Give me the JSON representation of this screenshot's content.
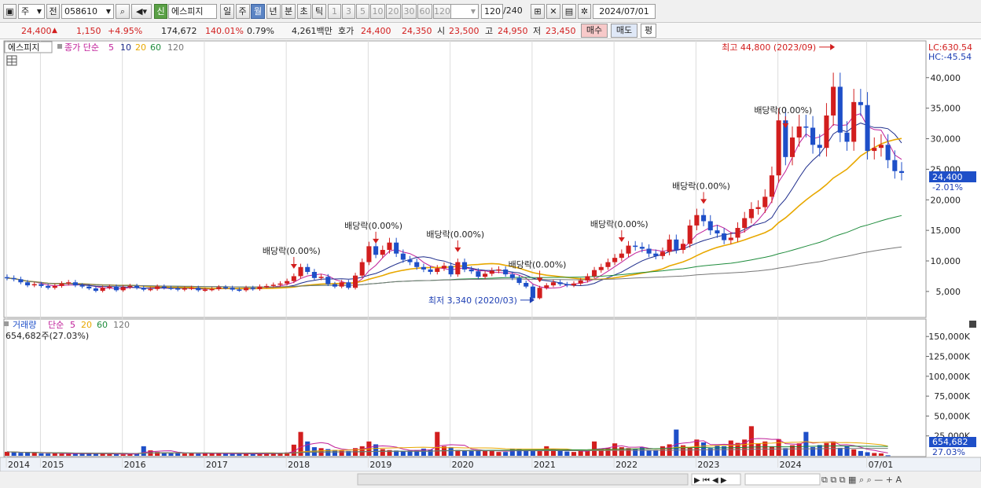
{
  "toolbar": {
    "market": "주",
    "prev": "전",
    "code": "058610",
    "stock_badge": "신",
    "stock_name": "에스피지",
    "periods": [
      "일",
      "주",
      "월",
      "년",
      "분",
      "초",
      "틱"
    ],
    "active_period": "월",
    "intervals": [
      "1",
      "3",
      "5",
      "10",
      "20",
      "30",
      "60",
      "120"
    ],
    "count": "120",
    "count_total": "/240",
    "date": "2024/07/01"
  },
  "quote": {
    "price": "24,400",
    "change": "1,150",
    "change_pct": "+4.95%",
    "volume": "174,672",
    "volume_ratio": "140.01%",
    "turnover": "0.79%",
    "amount": "4,261백만",
    "bid_label": "호가",
    "ask": "24,400",
    "bid": "24,350",
    "open_label": "시",
    "open": "23,500",
    "high_label": "고",
    "high": "24,950",
    "low_label": "저",
    "low": "23,450",
    "buy_label": "매수",
    "sell_label": "매도",
    "eval_label": "평"
  },
  "price_panel": {
    "name": "에스피지",
    "legend_label": "종가 단순",
    "ma_periods": [
      "5",
      "10",
      "20",
      "60",
      "120"
    ],
    "lc": "LC:630.54",
    "hc": "HC:-45.54",
    "current_price": "24,400",
    "current_change": "-2.01%",
    "annotation_high": "최고 44,800 (2023/09)",
    "annotation_low": "최저 3,340 (2020/03)",
    "dividend_label": "배당락(0.00%)"
  },
  "volume_panel": {
    "legend_label": "거래량",
    "legend_sub": "단순",
    "ma_periods": [
      "5",
      "20",
      "60",
      "120"
    ],
    "current_volume": "654,682주(27.03%)",
    "current_tag": "654,682",
    "current_pct_tag": "27.03%"
  },
  "colors": {
    "up": "#d21e1e",
    "down": "#1e4fc8",
    "ma5": "#c0209a",
    "ma10": "#1e2d8c",
    "ma20": "#e8a800",
    "ma60": "#1e8c3c",
    "ma120": "#777777"
  },
  "chart_data": {
    "type": "candlestick",
    "period": "monthly",
    "price_ticks": [
      5000,
      10000,
      15000,
      20000,
      25000,
      30000,
      35000,
      40000
    ],
    "price_tick_labels": [
      "5,000",
      "10,000",
      "15,000",
      "20,000",
      "25,000",
      "30,000",
      "35,000",
      "40,000"
    ],
    "price_range": [
      1000,
      45500
    ],
    "volume_ticks": [
      25000,
      50000,
      75000,
      100000,
      125000,
      150000
    ],
    "volume_tick_labels": [
      "25,000K",
      "50,000K",
      "75,000K",
      "100,000K",
      "125,000K",
      "150,000K"
    ],
    "volume_range": [
      0,
      168000
    ],
    "x_labels": [
      "2014",
      "2015",
      "2016",
      "2017",
      "2018",
      "2019",
      "2020",
      "2021",
      "2022",
      "2023",
      "2024",
      "07/01"
    ],
    "x_label_index": [
      0,
      5,
      17,
      29,
      41,
      53,
      65,
      77,
      89,
      101,
      113,
      126
    ],
    "series": [
      {
        "name": "candles",
        "monthly_close": [
          7200,
          7000,
          6500,
          6000,
          6200,
          5900,
          5600,
          5900,
          6300,
          6500,
          6000,
          5800,
          5500,
          5100,
          5600,
          5800,
          5200,
          5700,
          5900,
          5600,
          5300,
          5400,
          5800,
          5600,
          5500,
          5300,
          5500,
          5600,
          5200,
          5300,
          5400,
          5700,
          5600,
          5300,
          5200,
          5600,
          5400,
          5800,
          5900,
          6100,
          6300,
          6700,
          7500,
          9000,
          8200,
          7200,
          7400,
          6200,
          5800,
          6500,
          5600,
          7600,
          9800,
          12400,
          11000,
          11800,
          13000,
          11200,
          10200,
          9800,
          9000,
          8600,
          8200,
          8800,
          9200,
          7800,
          9800,
          8600,
          8300,
          7400,
          7900,
          8400,
          8600,
          7800,
          7200,
          6400,
          5800,
          3900,
          5600,
          6000,
          6500,
          6200,
          6000,
          6300,
          6800,
          7500,
          8500,
          9000,
          9800,
          10500,
          11200,
          12500,
          12300,
          12000,
          11200,
          10800,
          11500,
          13500,
          11800,
          12800,
          15800,
          17500,
          16500,
          15000,
          14500,
          13400,
          13800,
          15400,
          17000,
          18500,
          18800,
          20500,
          24000,
          33000,
          27000,
          30200,
          32000,
          31800,
          29000,
          28500,
          33800,
          38500,
          31000,
          29500,
          36000,
          35500,
          28000,
          28500,
          29000,
          26500,
          24700,
          24400
        ]
      },
      {
        "name": "volume_k",
        "values": [
          5000,
          4500,
          3800,
          4200,
          3600,
          3000,
          2800,
          3200,
          2600,
          2400,
          2800,
          3000,
          2600,
          2400,
          2600,
          2200,
          2000,
          1800,
          2400,
          2600,
          12000,
          6800,
          4800,
          4200,
          3600,
          3200,
          2800,
          3000,
          2600,
          3200,
          3000,
          2800,
          2600,
          2400,
          2400,
          2600,
          2200,
          2800,
          2800,
          3000,
          3600,
          4200,
          14000,
          30000,
          18000,
          10800,
          9600,
          8400,
          7200,
          6600,
          6000,
          9600,
          12000,
          18000,
          14400,
          8400,
          7200,
          6600,
          6000,
          6600,
          7200,
          9000,
          7800,
          30000,
          12000,
          10800,
          7200,
          6000,
          7200,
          6600,
          6000,
          6600,
          4800,
          4800,
          9000,
          8400,
          7200,
          6000,
          6000,
          12000,
          7800,
          6000,
          5400,
          4800,
          6000,
          6600,
          18000,
          9000,
          9600,
          15600,
          10800,
          9600,
          8400,
          10800,
          7200,
          7200,
          12000,
          14400,
          33000,
          13200,
          10800,
          20400,
          16800,
          9600,
          13200,
          12000,
          19200,
          16200,
          20400,
          37200,
          15600,
          18000,
          12000,
          21000,
          9600,
          13200,
          15600,
          30000,
          11000,
          13500,
          16000,
          18000,
          10000,
          12000,
          8000,
          6000,
          4500,
          3500,
          3000,
          654.682
        ]
      }
    ]
  }
}
